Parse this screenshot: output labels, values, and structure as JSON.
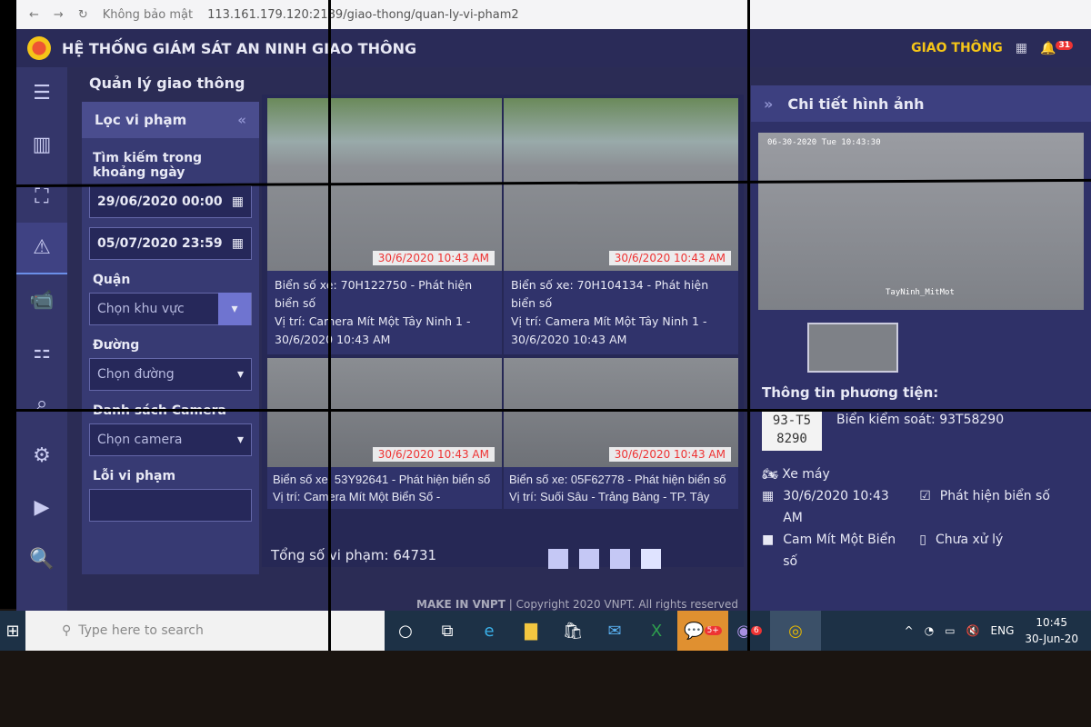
{
  "browser": {
    "security": "Không bảo mật",
    "url": "113.161.179.120:2189/giao-thong/quan-ly-vi-pham2"
  },
  "header": {
    "title": "HỆ THỐNG GIÁM SÁT AN NINH GIAO THÔNG",
    "module": "GIAO THÔNG",
    "notification_count": "31"
  },
  "page_title": "Quản lý giao thông",
  "filter": {
    "title": "Lọc vi phạm",
    "date_label": "Tìm kiếm trong khoảng ngày",
    "date_from": "29/06/2020 00:00",
    "date_to": "05/07/2020 23:59",
    "district_label": "Quận",
    "district_placeholder": "Chọn khu vực",
    "road_label": "Đường",
    "road_placeholder": "Chọn đường",
    "camera_label": "Danh sách Camera",
    "camera_placeholder": "Chọn camera",
    "violation_label": "Lỗi vi phạm"
  },
  "violations": [
    {
      "stamp": "30/6/2020 10:43 AM",
      "plate": "Biển số xe: 70H122750  - Phát hiện biển số",
      "location": "Vị trí: Camera Mít Một Tây Ninh 1  - 30/6/2020 10:43 AM"
    },
    {
      "stamp": "30/6/2020 10:43 AM",
      "plate": "Biển số xe: 70H104134  - Phát hiện biển số",
      "location": "Vị trí: Camera Mít Một Tây Ninh 1  - 30/6/2020 10:43 AM"
    },
    {
      "stamp": "30/6/2020 10:43 AM",
      "plate": "Biển số xe: 53Y92641  - Phát hiện biển số",
      "location": "Vị trí: Camera Mít Một Biển Số  -"
    },
    {
      "stamp": "30/6/2020 10:43 AM",
      "plate": "Biển số xe: 05F62778  - Phát hiện biển số",
      "location": "Vị trí: Suối Sâu - Trảng Bàng - TP. Tây"
    }
  ],
  "total": "Tổng số vi phạm: 64731",
  "footer": {
    "make": "MAKE IN VNPT",
    "copyright": "| Copyright 2020 VNPT. All rights reserved"
  },
  "detail": {
    "title": "Chi tiết hình ảnh",
    "overlay_time": "06-30-2020 Tue 10:43:30",
    "overlay_cam": "TayNinh_MitMot",
    "info_title": "Thông tin phương tiện:",
    "plate_image_line1": "93-T5",
    "plate_image_line2": "8290",
    "plate": "Biển kiểm soát: 93T58290",
    "vehicle": "Xe máy",
    "time": "30/6/2020 10:43 AM",
    "type": "Phát hiện biển số",
    "camera": "Cam Mít Một Biển số",
    "status": "Chưa xử lý"
  },
  "taskbar": {
    "search_placeholder": "Type here to search",
    "badge_mail": "5+",
    "badge_viber": "6",
    "lang": "ENG",
    "time": "10:45",
    "date": "30-Jun-20"
  }
}
